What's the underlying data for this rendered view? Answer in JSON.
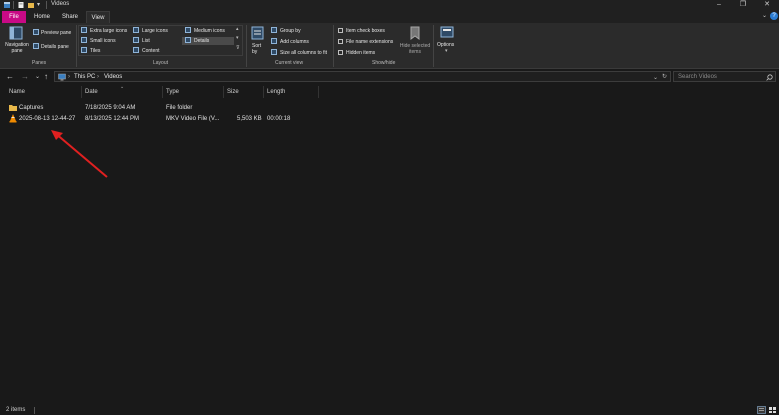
{
  "window": {
    "title": "Videos",
    "controls": {
      "minimize": "–",
      "maximize": "❐",
      "close": "✕"
    }
  },
  "ribbon_tabs": [
    {
      "label": "File"
    },
    {
      "label": "Home"
    },
    {
      "label": "Share"
    },
    {
      "label": "View"
    }
  ],
  "ribbon": {
    "panes": {
      "navigation_pane": "Navigation pane",
      "preview_pane": "Preview pane",
      "details_pane": "Details pane",
      "group_label": "Panes"
    },
    "layout": {
      "items": [
        "Extra large icons",
        "Large icons",
        "Medium icons",
        "Small icons",
        "List",
        "Details",
        "Tiles",
        "Content"
      ],
      "selected": "Details",
      "group_label": "Layout"
    },
    "current_view": {
      "sort_by": "Sort by",
      "group_by": "Group by",
      "add_columns": "Add columns",
      "size_all_columns": "Size all columns to fit",
      "group_label": "Current view"
    },
    "show_hide": {
      "item_check_boxes": "Item check boxes",
      "file_name_extensions": "File name extensions",
      "hidden_items": "Hidden items",
      "hide_selected_items": "Hide selected items",
      "group_label": "Show/hide"
    },
    "options": "Options"
  },
  "address": {
    "breadcrumb": [
      "This PC",
      "Videos"
    ],
    "search_placeholder": "Search Videos"
  },
  "columns": [
    "Name",
    "Date",
    "Type",
    "Size",
    "Length"
  ],
  "files": [
    {
      "name": "Captures",
      "date": "7/18/2025 9:04 AM",
      "type": "File folder",
      "size": "",
      "length": "",
      "icon": "folder-icon"
    },
    {
      "name": "2025-08-13 12-44-27",
      "date": "8/13/2025 12:44 PM",
      "type": "MKV Video File (V...",
      "size": "5,503 KB",
      "length": "00:00:18",
      "icon": "vlc-cone-icon"
    }
  ],
  "status": {
    "item_count": "2 items"
  },
  "colors": {
    "file_tab": "#c90a86",
    "background": "#191919",
    "ribbon": "#2b2b2b",
    "annotation_arrow": "#e02020",
    "folder": "#e8b84a"
  }
}
